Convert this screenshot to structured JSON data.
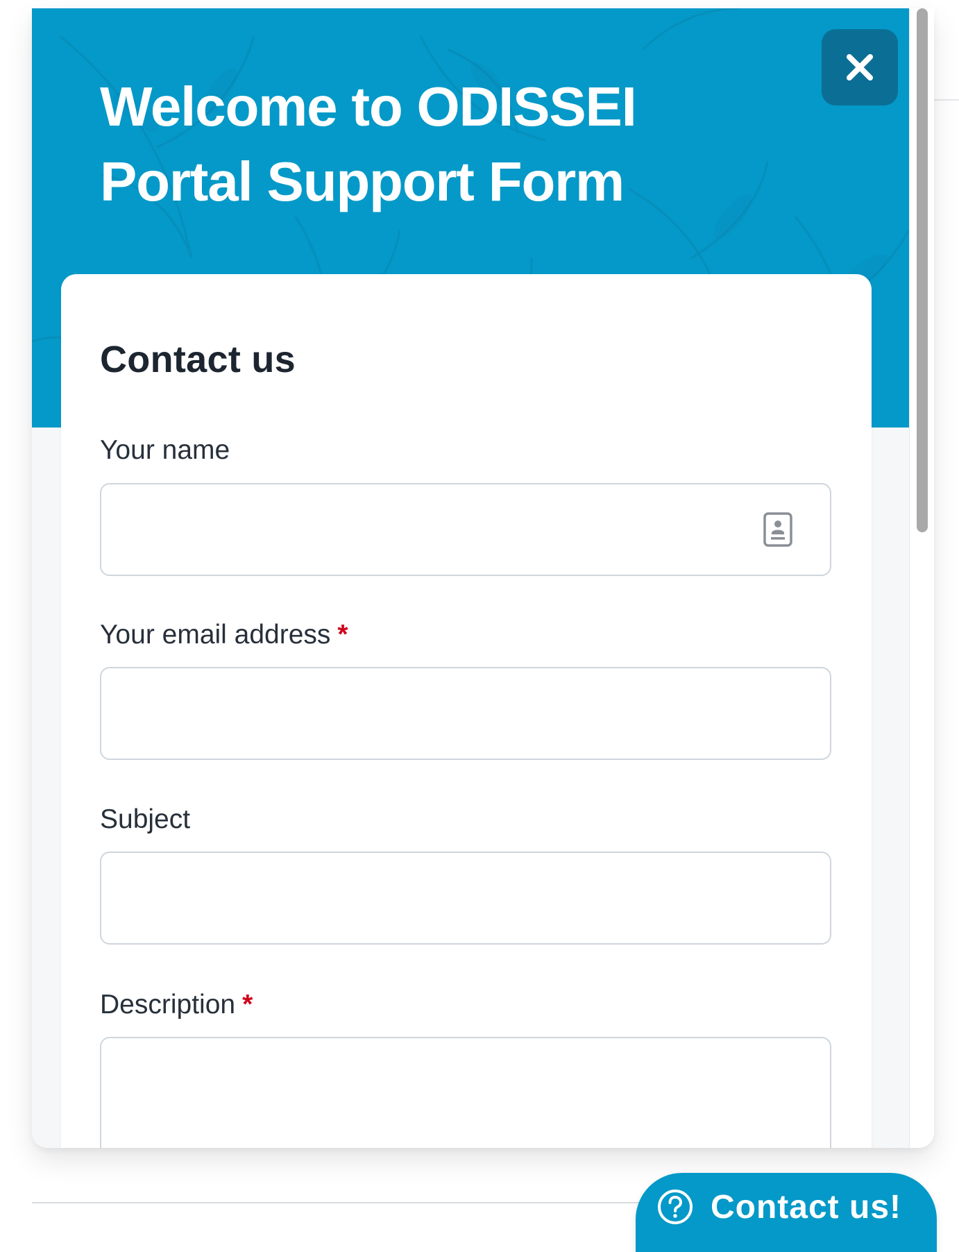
{
  "widget": {
    "title": "Welcome to ODISSEI Portal Support Form",
    "close_icon": "close-icon",
    "brand_color": "#0499c8"
  },
  "form": {
    "heading": "Contact us",
    "fields": [
      {
        "label": "Your name",
        "required": false,
        "value": ""
      },
      {
        "label": "Your email address",
        "required": true,
        "value": ""
      },
      {
        "label": "Subject",
        "required": false,
        "value": ""
      },
      {
        "label": "Description",
        "required": true,
        "value": ""
      }
    ],
    "required_mark": "*",
    "required_color": "#d0021b",
    "autofill_icon": "contact-card-icon"
  },
  "launcher": {
    "label": "Contact us!",
    "icon": "question-circle-icon"
  }
}
